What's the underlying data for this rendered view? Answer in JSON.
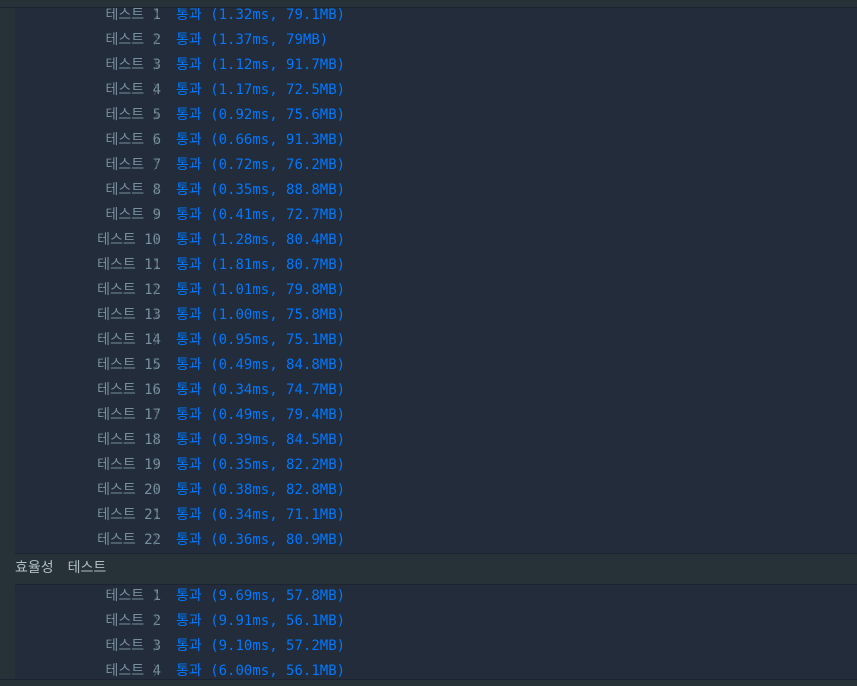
{
  "correctness_tests": [
    {
      "name": "테스트 1",
      "status": "통과",
      "detail": "(1.32ms, 79.1MB)"
    },
    {
      "name": "테스트 2",
      "status": "통과",
      "detail": "(1.37ms, 79MB)"
    },
    {
      "name": "테스트 3",
      "status": "통과",
      "detail": "(1.12ms, 91.7MB)"
    },
    {
      "name": "테스트 4",
      "status": "통과",
      "detail": "(1.17ms, 72.5MB)"
    },
    {
      "name": "테스트 5",
      "status": "통과",
      "detail": "(0.92ms, 75.6MB)"
    },
    {
      "name": "테스트 6",
      "status": "통과",
      "detail": "(0.66ms, 91.3MB)"
    },
    {
      "name": "테스트 7",
      "status": "통과",
      "detail": "(0.72ms, 76.2MB)"
    },
    {
      "name": "테스트 8",
      "status": "통과",
      "detail": "(0.35ms, 88.8MB)"
    },
    {
      "name": "테스트 9",
      "status": "통과",
      "detail": "(0.41ms, 72.7MB)"
    },
    {
      "name": "테스트 10",
      "status": "통과",
      "detail": "(1.28ms, 80.4MB)"
    },
    {
      "name": "테스트 11",
      "status": "통과",
      "detail": "(1.81ms, 80.7MB)"
    },
    {
      "name": "테스트 12",
      "status": "통과",
      "detail": "(1.01ms, 79.8MB)"
    },
    {
      "name": "테스트 13",
      "status": "통과",
      "detail": "(1.00ms, 75.8MB)"
    },
    {
      "name": "테스트 14",
      "status": "통과",
      "detail": "(0.95ms, 75.1MB)"
    },
    {
      "name": "테스트 15",
      "status": "통과",
      "detail": "(0.49ms, 84.8MB)"
    },
    {
      "name": "테스트 16",
      "status": "통과",
      "detail": "(0.34ms, 74.7MB)"
    },
    {
      "name": "테스트 17",
      "status": "통과",
      "detail": "(0.49ms, 79.4MB)"
    },
    {
      "name": "테스트 18",
      "status": "통과",
      "detail": "(0.39ms, 84.5MB)"
    },
    {
      "name": "테스트 19",
      "status": "통과",
      "detail": "(0.35ms, 82.2MB)"
    },
    {
      "name": "테스트 20",
      "status": "통과",
      "detail": "(0.38ms, 82.8MB)"
    },
    {
      "name": "테스트 21",
      "status": "통과",
      "detail": "(0.34ms, 71.1MB)"
    },
    {
      "name": "테스트 22",
      "status": "통과",
      "detail": "(0.36ms, 80.9MB)"
    }
  ],
  "efficiency_header": {
    "word1": "효율성",
    "word2": "테스트"
  },
  "efficiency_tests": [
    {
      "name": "테스트 1",
      "status": "통과",
      "detail": "(9.69ms, 57.8MB)"
    },
    {
      "name": "테스트 2",
      "status": "통과",
      "detail": "(9.91ms, 56.1MB)"
    },
    {
      "name": "테스트 3",
      "status": "통과",
      "detail": "(9.10ms, 57.2MB)"
    },
    {
      "name": "테스트 4",
      "status": "통과",
      "detail": "(6.00ms, 56.1MB)"
    }
  ],
  "separator_glyph": "〉",
  "colors": {
    "pass": "#0078ff",
    "label": "#78909c",
    "background": "#222c3a"
  }
}
